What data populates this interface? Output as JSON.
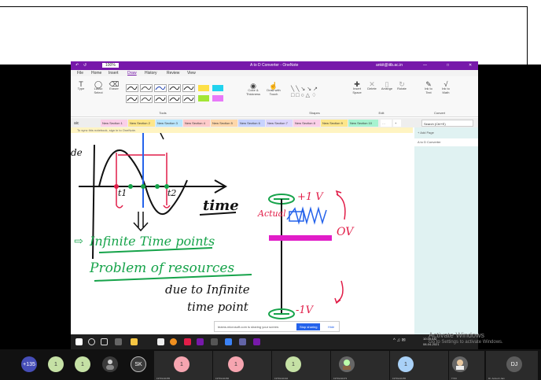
{
  "window": {
    "title": "A to D Converter - OneNote",
    "zoom": "100%",
    "account": "ankit@iitb.ac.in"
  },
  "menu": [
    "File",
    "Home",
    "Insert",
    "Draw",
    "History",
    "Review",
    "View"
  ],
  "ribbon": {
    "type": "Type",
    "lasso": "Lasso Select",
    "eraser": "Eraser",
    "tools_group": "Tools",
    "color_thickness": "Color & Thickness",
    "draw_touch": "Draw with Touch",
    "shapes_group": "Shapes",
    "insert_space": "Insert Space",
    "delete": "Delete",
    "arrange": "Arrange",
    "rotate": "Rotate",
    "edit_group": "Edit",
    "ink_to_text": "Ink to Text",
    "ink_to_math": "Ink to Math",
    "convert_group": "Convert"
  },
  "notebook": "aic",
  "section_tabs": [
    "New Section 1",
    "New Section 2",
    "New Section 3",
    "New Section 4",
    "New Section 5",
    "New Section 6",
    "New Section 7",
    "New Section 8",
    "New Section 9",
    "New Section 10"
  ],
  "search_placeholder": "Search (Ctrl+E)",
  "infobar_text": "To sync this notebook, sign in to OneNote.",
  "pages": {
    "add_page": "+ Add Page",
    "items": [
      "A to D Converter"
    ]
  },
  "ink": {
    "time": "time",
    "t1": "t1",
    "t2": "t2",
    "plus1v": "+1 V",
    "actual": "Actual",
    "ov": "OV",
    "minus1v": "-1V",
    "infinite_time_points": "Infinite Time points",
    "problem_of_resources": "Problem of resources",
    "due_to_infinite": "due to Infinite",
    "time_point": "time point"
  },
  "share_bar": {
    "message": "teams.microsoft.com is sharing your screen.",
    "stop_button": "Stop sharing",
    "hide_button": "Hide"
  },
  "taskbar": {
    "time": "10:39 AM",
    "date": "08-04-2021"
  },
  "watermark": {
    "line1": "Activate Windows",
    "line2": "Go to Settings to activate Windows."
  },
  "participants": [
    {
      "initials": "+135",
      "color": "#464eb8"
    },
    {
      "initials": "1",
      "color": "#c5e1a5"
    },
    {
      "initials": "1",
      "color": "#c5e1a5"
    },
    {
      "initials": "SK",
      "color": "#3a3a3a"
    }
  ],
  "tiles": [
    {
      "initial": "1",
      "color": "#f6a5b0",
      "name": "19T01A0455"
    },
    {
      "initial": "1",
      "color": "#f6a5b0",
      "name": "19T01A0456"
    },
    {
      "initial": "1",
      "color": "#c5e1a5",
      "name": "19T01A0442"
    },
    {
      "initial": "",
      "color": "#666",
      "name": "19T01A0473"
    },
    {
      "initial": "1",
      "color": "#a9d1f7",
      "name": "19T01A0455"
    },
    {
      "initial": "",
      "color": "#666",
      "name": "T723"
    },
    {
      "initial": "DJ",
      "color": "#5c5c5c",
      "name": "Dr. Ankush Jain"
    }
  ]
}
